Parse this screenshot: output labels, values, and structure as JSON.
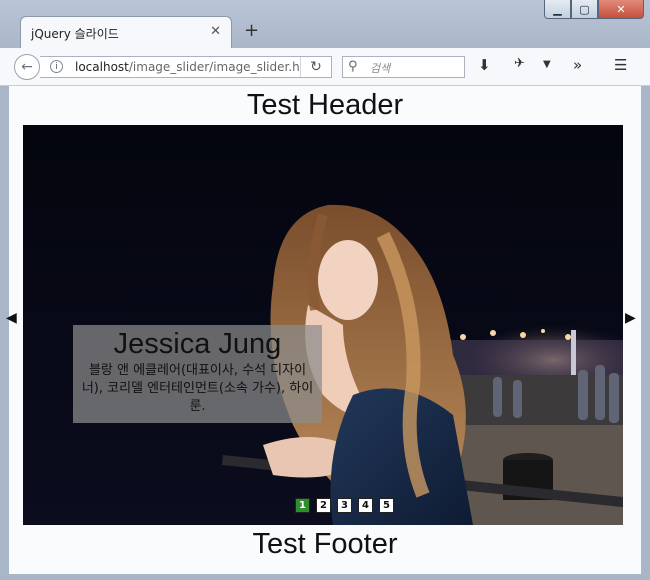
{
  "browser": {
    "tab_title": "jQuery 슬라이드",
    "url_host": "localhost",
    "url_path": "/image_slider/image_slider.h",
    "search_placeholder": "검색"
  },
  "page": {
    "header": "Test Header",
    "footer": "Test Footer",
    "prev_arrow": "◀",
    "next_arrow": "▶"
  },
  "slider": {
    "caption_title": "Jessica Jung",
    "caption_text": "블랑 앤 에클레어(대표이사, 수석 디자이너), 코리델 엔터테인먼트(소속 가수), 하이룬.",
    "pages": [
      "1",
      "2",
      "3",
      "4",
      "5"
    ],
    "active_page": 1
  }
}
